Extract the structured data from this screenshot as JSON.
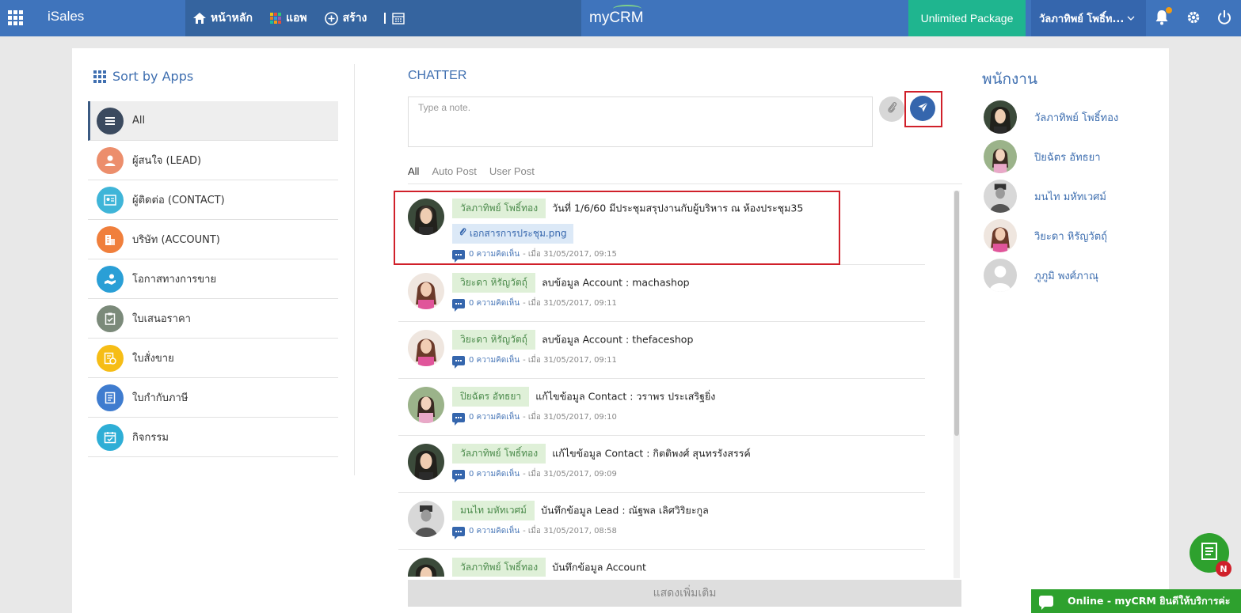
{
  "topbar": {
    "brand": "iSales",
    "nav": [
      {
        "label": "หน้าหลัก",
        "icon": "home-icon"
      },
      {
        "label": "แอพ",
        "icon": "apps-icon"
      },
      {
        "label": "สร้าง",
        "icon": "plus-circle-icon"
      }
    ],
    "logo": "myCRM",
    "package": "Unlimited Package",
    "user": "วัลภาทิพย์ โพธิ์ท...",
    "accent": "#3f74bc",
    "package_color": "#1fb58f"
  },
  "sidebar": {
    "title": "Sort by Apps",
    "items": [
      {
        "label": "All",
        "color": "#3b4a5f",
        "icon": "list-icon"
      },
      {
        "label": "ผู้สนใจ (LEAD)",
        "color": "#ec8e6c",
        "icon": "person-icon"
      },
      {
        "label": "ผู้ติดต่อ (CONTACT)",
        "color": "#3fb5d8",
        "icon": "contact-card-icon"
      },
      {
        "label": "บริษัท (ACCOUNT)",
        "color": "#f07f3c",
        "icon": "building-icon"
      },
      {
        "label": "โอกาสทางการขาย",
        "color": "#2a9fd6",
        "icon": "hand-coin-icon"
      },
      {
        "label": "ใบเสนอราคา",
        "color": "#7b8a7a",
        "icon": "clipboard-icon"
      },
      {
        "label": "ใบสั่งขาย",
        "color": "#f6bd16",
        "icon": "order-icon"
      },
      {
        "label": "ใบกำกับภาษี",
        "color": "#3f7ccf",
        "icon": "invoice-icon"
      },
      {
        "label": "กิจกรรม",
        "color": "#2eaed6",
        "icon": "calendar-icon"
      }
    ]
  },
  "chatter": {
    "title": "CHATTER",
    "placeholder": "Type a note.",
    "tabs": [
      "All",
      "Auto Post",
      "User Post"
    ],
    "more": "แสดงเพิ่มเติม",
    "posts": [
      {
        "author": "วัลภาทิพย์ โพธิ์ทอง",
        "text": "วันที่ 1/6/60 มีประชุมสรุปงานกับผู้บริหาร ณ ห้องประชุม35",
        "attachment": "เอกสารการประชุม.png",
        "comments": "0 ความคิดเห็น",
        "date": "- เมื่อ 31/05/2017, 09:15"
      },
      {
        "author": "วิยะดา หิรัญวัตถุ์",
        "text": "ลบข้อมูล Account : machashop",
        "comments": "0 ความคิดเห็น",
        "date": "- เมื่อ 31/05/2017, 09:11"
      },
      {
        "author": "วิยะดา หิรัญวัตถุ์",
        "text": "ลบข้อมูล Account : thefaceshop",
        "comments": "0 ความคิดเห็น",
        "date": "- เมื่อ 31/05/2017, 09:11"
      },
      {
        "author": "ปิยฉัตร อัทธยา",
        "text": "แก้ไขข้อมูล Contact : วราพร ประเสริฐยิ่ง",
        "comments": "0 ความคิดเห็น",
        "date": "- เมื่อ 31/05/2017, 09:10"
      },
      {
        "author": "วัลภาทิพย์ โพธิ์ทอง",
        "text": "แก้ไขข้อมูล Contact : กิตติพงศ์ สุนทรรังสรรค์",
        "comments": "0 ความคิดเห็น",
        "date": "- เมื่อ 31/05/2017, 09:09"
      },
      {
        "author": "มนไท มหัทเวศม์",
        "text": "บันทึกข้อมูล Lead : ณัฐพล เลิศวิริยะกูล",
        "comments": "0 ความคิดเห็น",
        "date": "- เมื่อ 31/05/2017, 08:58"
      },
      {
        "author": "วัลภาทิพย์ โพธิ์ทอง",
        "text": "บันทึกข้อมูล Account",
        "comments": "",
        "date": ""
      }
    ]
  },
  "employees": {
    "title": "พนักงาน",
    "list": [
      {
        "name": "วัลภาทิพย์ โพธิ์ทอง"
      },
      {
        "name": "ปิยฉัตร อัทธยา"
      },
      {
        "name": "มนไท มหัทเวศม์"
      },
      {
        "name": "วิยะดา หิรัญวัตถุ์"
      },
      {
        "name": "ภูภูมิ พงศ์ภาณุ"
      }
    ]
  },
  "floating": {
    "badge": "N",
    "online": "Online - myCRM ยินดีให้บริการค่ะ"
  }
}
